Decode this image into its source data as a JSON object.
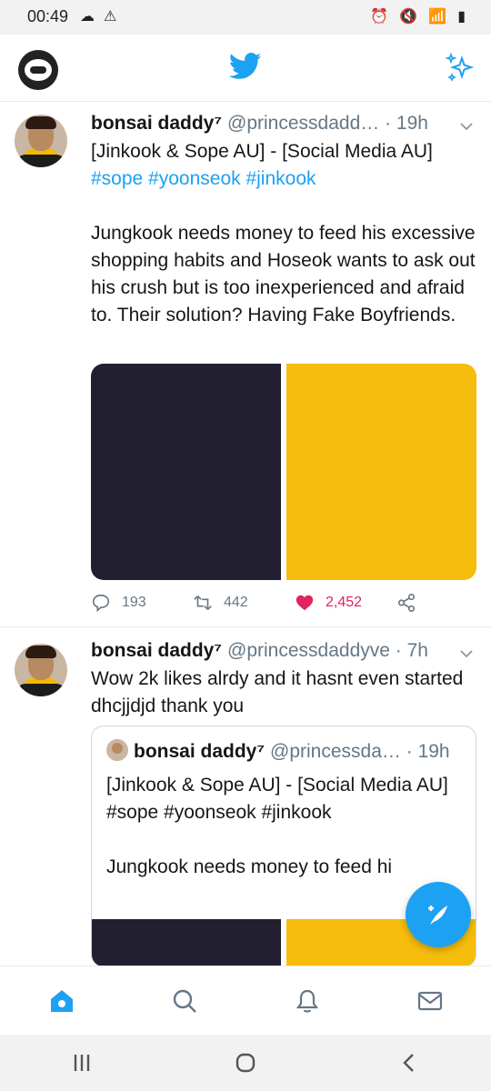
{
  "status_bar": {
    "time": "00:49"
  },
  "tweets": [
    {
      "display_name": "bonsai daddy⁷",
      "handle": "@princessdadd…",
      "time": "· 19h",
      "text_line1": "[Jinkook & Sope AU] - [Social Media AU]",
      "hashtags": "#sope #yoonseok #jinkook",
      "text_body": "Jungkook needs money to feed his excessive shopping habits and Hoseok wants to ask out his crush but is too inexperienced and afraid to. Their solution? Having Fake Boyfriends.",
      "replies": "193",
      "retweets": "442",
      "likes": "2,452"
    },
    {
      "display_name": "bonsai daddy⁷",
      "handle": "@princessdaddyve",
      "time": "· 7h",
      "text_body": "Wow 2k likes alrdy and it hasnt even started dhcjjdjd thank you",
      "quote": {
        "display_name": "bonsai daddy⁷",
        "handle": "@princessda…",
        "time": "· 19h",
        "text_line1": "[Jinkook & Sope AU] - [Social Media AU]",
        "hashtags": "#sope #yoonseok #jinkook",
        "text_body": "Jungkook needs money to feed hi"
      }
    }
  ],
  "colors": {
    "brand_blue": "#1da1f2",
    "like_red": "#e0245e",
    "image_dark": "#221f30",
    "image_yellow": "#f6bd0c"
  }
}
